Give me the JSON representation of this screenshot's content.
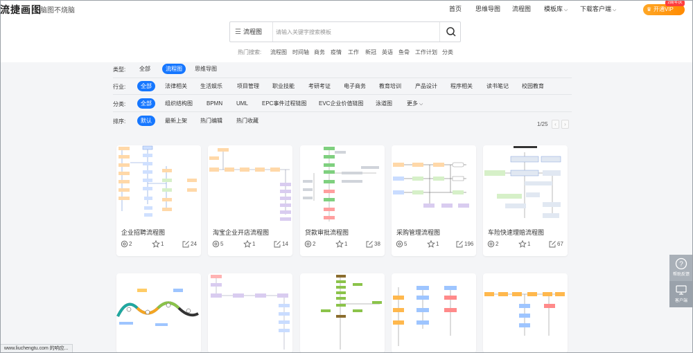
{
  "brand": {
    "logo": "流捷画图",
    "slogan": "脑图不烧脑"
  },
  "nav": {
    "home": "首页",
    "mindmap": "思维导图",
    "flowchart": "流程图",
    "templates": "模板库",
    "download": "下载客户端"
  },
  "vip": {
    "label": "开通VIP",
    "badge": "2周年庆"
  },
  "search": {
    "type_label": "流程图",
    "placeholder": "请输入关键字搜索模板"
  },
  "hot": {
    "label": "热门搜索:",
    "items": [
      "流程图",
      "时间轴",
      "商务",
      "疫情",
      "工作",
      "新冠",
      "英语",
      "鱼骨",
      "工作计划",
      "分类"
    ]
  },
  "filters": {
    "type": {
      "label": "类型:",
      "options": [
        "全部",
        "流程图",
        "思维导图"
      ],
      "active": 1
    },
    "industry": {
      "label": "行业:",
      "options": [
        "全部",
        "法律相关",
        "生活娱乐",
        "项目管理",
        "职业技能",
        "考研考证",
        "电子商务",
        "教育培训",
        "产品设计",
        "程序相关",
        "读书笔记",
        "校园教育"
      ],
      "active": 0
    },
    "category": {
      "label": "分类:",
      "options": [
        "全部",
        "组织结构图",
        "BPMN",
        "UML",
        "EPC事件过程链图",
        "EVC企业价值链图",
        "泳道图",
        "更多"
      ],
      "active": 0
    },
    "sort": {
      "label": "排序:",
      "options": [
        "默认",
        "最新上架",
        "热门编辑",
        "热门收藏"
      ],
      "active": 0
    }
  },
  "pager": {
    "text": "1/25",
    "prev": "‹",
    "next": "›"
  },
  "cards": [
    {
      "title": "企业招聘流程图",
      "views": "2",
      "stars": "1",
      "edits": "24"
    },
    {
      "title": "淘宝企业开店流程图",
      "views": "5",
      "stars": "1",
      "edits": "14"
    },
    {
      "title": "贷款审批流程图",
      "views": "2",
      "stars": "1",
      "edits": "38"
    },
    {
      "title": "采购管理流程图",
      "views": "5",
      "stars": "1",
      "edits": "196"
    },
    {
      "title": "车险快速理赔流程图",
      "views": "2",
      "stars": "1",
      "edits": "67"
    }
  ],
  "side": {
    "feedback": "帮助反馈",
    "client": "客户端"
  },
  "status_text": "www.liuchengtu.com 的响应...",
  "colors": {
    "accent": "#1677ff",
    "vip": "#ff9800"
  }
}
